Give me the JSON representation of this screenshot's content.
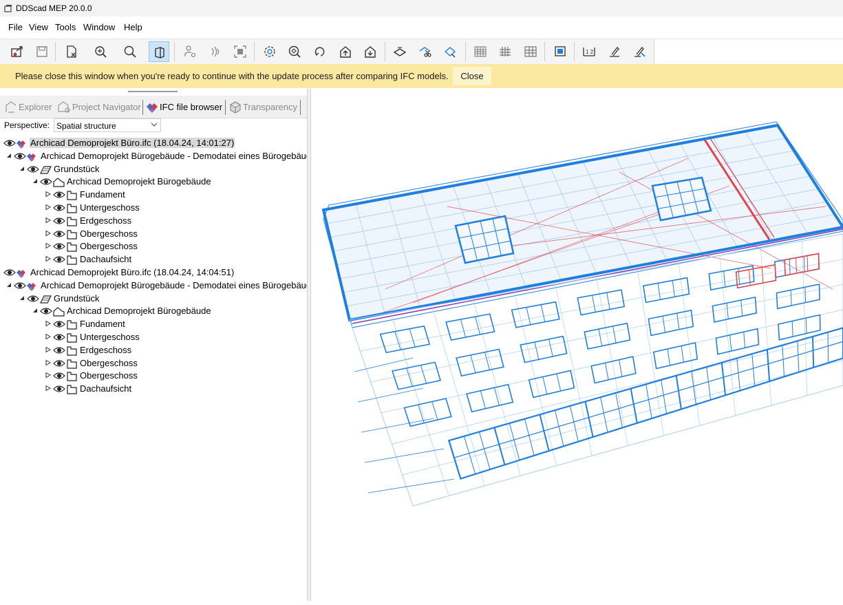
{
  "window": {
    "title": "DDScad MEP 20.0.0"
  },
  "menu": [
    "File",
    "View",
    "Tools",
    "Window",
    "Help"
  ],
  "toolbar": {
    "buttons": [
      "open-ifc-icon",
      "save-icon",
      "close-doc-icon",
      "zoom-extents-icon",
      "zoom-icon",
      "view-3d-icon",
      "user-settings-icon",
      "signal-icon",
      "fit-selection-icon",
      "orbit-icon",
      "pan-icon",
      "rotate-icon",
      "house-up-icon",
      "house-down-icon",
      "plane-icon",
      "cut-icon",
      "section-icon",
      "grid-pattern-icon",
      "grid-dense-icon",
      "grid-table-icon",
      "screen-capture-icon",
      "measure-icon",
      "brush-icon",
      "edit-brush-icon"
    ],
    "active_button": "view-3d-icon"
  },
  "infobar": {
    "message": "Please close this window when you're ready to continue with the update process after comparing IFC models.",
    "close_label": "Close"
  },
  "panel": {
    "tabs": [
      {
        "label": "Explorer",
        "icon": "explorer-icon",
        "active": false
      },
      {
        "label": "Project Navigator",
        "icon": "navigator-icon",
        "active": false
      },
      {
        "label": "IFC file browser",
        "icon": "ifc-icon",
        "active": true
      },
      {
        "label": "Transparency",
        "icon": "cube-icon",
        "active": false
      }
    ],
    "perspective_label": "Perspective:",
    "perspective_value": "Spatial structure"
  },
  "tree": [
    {
      "label": "Archicad Demoprojekt Büro.ifc (18.04.24, 14:01:27)",
      "level": 0,
      "expander": "none",
      "icon": "ifc-file-icon",
      "selected": true
    },
    {
      "label": "Archicad Demoprojekt Bürogebäude - Demodatei eines Bürogebäudes mit",
      "level": 1,
      "expander": "expanded",
      "icon": "ifc-project-icon"
    },
    {
      "label": "Grundstück",
      "level": 2,
      "expander": "expanded",
      "icon": "site-icon"
    },
    {
      "label": "Archicad Demoprojekt Bürogebäude",
      "level": 3,
      "expander": "expanded",
      "icon": "building-icon"
    },
    {
      "label": "Fundament",
      "level": 4,
      "expander": "collapsed",
      "icon": "storey-icon"
    },
    {
      "label": "Untergeschoss",
      "level": 4,
      "expander": "collapsed",
      "icon": "storey-icon"
    },
    {
      "label": "Erdgeschoss",
      "level": 4,
      "expander": "collapsed",
      "icon": "storey-icon"
    },
    {
      "label": "Obergeschoss",
      "level": 4,
      "expander": "collapsed",
      "icon": "storey-icon"
    },
    {
      "label": "Obergeschoss",
      "level": 4,
      "expander": "collapsed",
      "icon": "storey-icon"
    },
    {
      "label": "Dachaufsicht",
      "level": 4,
      "expander": "collapsed",
      "icon": "storey-icon"
    },
    {
      "label": "Archicad Demoprojekt Büro.ifc (18.04.24, 14:04:51)",
      "level": 0,
      "expander": "none",
      "icon": "ifc-file-icon"
    },
    {
      "label": "Archicad Demoprojekt Bürogebäude - Demodatei eines Bürogebäudes mit",
      "level": 1,
      "expander": "expanded",
      "icon": "ifc-project-icon"
    },
    {
      "label": "Grundstück",
      "level": 2,
      "expander": "expanded",
      "icon": "site-icon"
    },
    {
      "label": "Archicad Demoprojekt Bürogebäude",
      "level": 3,
      "expander": "expanded",
      "icon": "building-icon"
    },
    {
      "label": "Fundament",
      "level": 4,
      "expander": "collapsed",
      "icon": "storey-icon"
    },
    {
      "label": "Untergeschoss",
      "level": 4,
      "expander": "collapsed",
      "icon": "storey-icon"
    },
    {
      "label": "Erdgeschoss",
      "level": 4,
      "expander": "collapsed",
      "icon": "storey-icon"
    },
    {
      "label": "Obergeschoss",
      "level": 4,
      "expander": "collapsed",
      "icon": "storey-icon"
    },
    {
      "label": "Obergeschoss",
      "level": 4,
      "expander": "collapsed",
      "icon": "storey-icon"
    },
    {
      "label": "Dachaufsicht",
      "level": 4,
      "expander": "collapsed",
      "icon": "storey-icon"
    }
  ],
  "viewport": {
    "content": "3d-wireframe-building-model",
    "colors": {
      "model_a": "#1f7fe0",
      "model_b": "#e0464b",
      "faint": "#a9cdf3"
    }
  },
  "colors": {
    "infobar": "#fbe9a2",
    "selection": "#d9d9d9",
    "active_tool": "#cce4f7"
  }
}
